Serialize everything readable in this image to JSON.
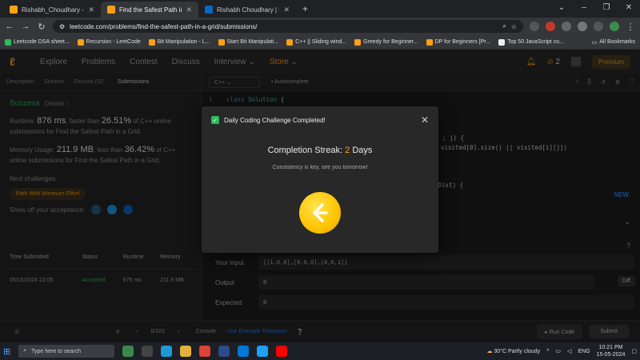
{
  "browser": {
    "tabs": [
      {
        "title": "Rishabh_Choudhary - LeetCode",
        "color": "#ffa116"
      },
      {
        "title": "Find the Safest Path in a Grid",
        "color": "#ffa116"
      },
      {
        "title": "Rishabh Choudhary | LinkedIn",
        "color": "#0a66c2"
      }
    ],
    "url": "leetcode.com/problems/find-the-safest-path-in-a-grid/submissions/",
    "bookmarks": [
      {
        "label": "Leetcode DSA sheet...",
        "color": "#2cbb5d"
      },
      {
        "label": "Recursion - LeetCode",
        "color": "#ffa116"
      },
      {
        "label": "Bit Manipulation - L...",
        "color": "#ffa116"
      },
      {
        "label": "Start Bit Manipulati...",
        "color": "#ffa116"
      },
      {
        "label": "C++ || Sliding wind...",
        "color": "#ffa116"
      },
      {
        "label": "Greedy for Beginner...",
        "color": "#ffa116"
      },
      {
        "label": "DP for Beginners [Pr...",
        "color": "#ffa116"
      },
      {
        "label": "Top 50 JavaScript co...",
        "color": "#eeeeee"
      }
    ],
    "all_bookmarks": "All Bookmarks"
  },
  "nav": {
    "items": [
      "Explore",
      "Problems",
      "Contest",
      "Discuss",
      "Interview"
    ],
    "store": "Store",
    "streak_count": "2",
    "premium": "Premium"
  },
  "left": {
    "tabs": [
      "Description",
      "Solution",
      "Discuss (52...",
      "Submissions"
    ],
    "status": "Success",
    "details": "Details",
    "runtime_label": "Runtime:",
    "runtime_value": "876 ms",
    "runtime_mid": ", faster than",
    "runtime_pct": "26.51%",
    "runtime_tail": "of C++ online submissions for Find the Safest Path in a Grid.",
    "memory_label": "Memory Usage:",
    "memory_value": "211.9 MB",
    "memory_mid": ", less than",
    "memory_pct": "36.42%",
    "memory_tail": "of C++ online submissions for Find the Safest Path in a Grid.",
    "next_label": "Next challenges:",
    "next_chip": "Path With Minimum Effort",
    "share_label": "Show off your acceptance:",
    "table": {
      "headers": [
        "Time Submitted",
        "Status",
        "Runtime",
        "Memory"
      ],
      "rows": [
        [
          "05/15/2024 22:05",
          "Accepted",
          "876 ms",
          "211.9 MB"
        ]
      ]
    }
  },
  "editor": {
    "lang": "C++",
    "autocomplete": "Autocomplete",
    "line_no": "1",
    "code_kw": "class",
    "code_cls": "Solution",
    "code_brace": "{",
    "frag1": "; j) {",
    "frag2": "visited[0].size() || visited[i][j])",
    "frag3": "oDist) {",
    "new_badge": "NEW",
    "your_input_label": "Your input",
    "your_input": "[[1,0,0],[0,0,0],[0,0,1]]",
    "output_label": "Output",
    "output": "0",
    "expected_label": "Expected",
    "expected": "0",
    "diff": "Diff"
  },
  "bottom": {
    "page": "0/101",
    "console": "Console",
    "use_example": "Use Example Testcases",
    "run": "Run Code",
    "submit": "Submit"
  },
  "modal": {
    "title": "Daily Coding Challenge Completed!",
    "streak_label": "Completion Streak:",
    "streak_num": "2",
    "streak_unit": "Days",
    "message": "Consistency is key, see you tomorrow!"
  },
  "taskbar": {
    "search": "Type here to search",
    "weather": "30°C  Partly cloudy",
    "lang": "ENG",
    "time": "10:21 PM",
    "date": "15-05-2024"
  }
}
